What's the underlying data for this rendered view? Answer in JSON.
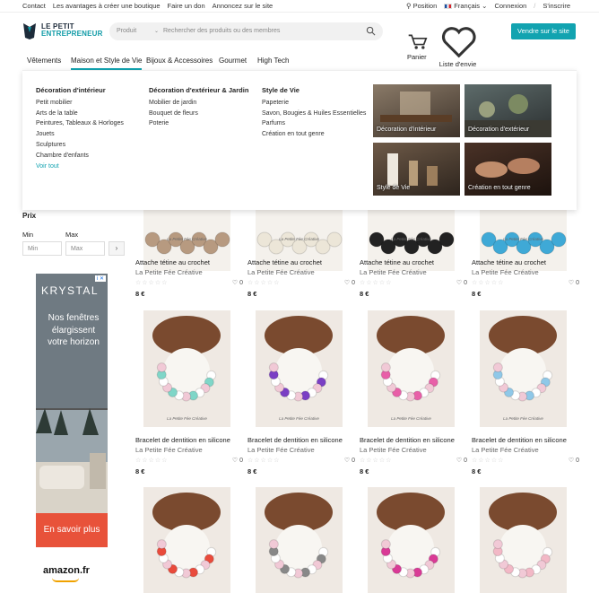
{
  "topbar": {
    "links": [
      "Contact",
      "Les avantages à créer une boutique",
      "Faire un don",
      "Annoncez sur le site"
    ],
    "position": "Position",
    "language": "Français",
    "login": "Connexion",
    "slash": "/",
    "signup": "S'inscrire"
  },
  "logo": {
    "line1": "LE PETIT",
    "line2": "ENTREPRENEUR"
  },
  "search": {
    "category": "Produit",
    "placeholder": "Rechercher des produits ou des membres"
  },
  "header": {
    "cart": "Panier",
    "wishlist": "Liste d'envie",
    "sell": "Vendre sur le site"
  },
  "nav": {
    "items": [
      "Vêtements",
      "Maison et Style de Vie",
      "Bijoux & Accessoires",
      "Gourmet",
      "High Tech"
    ]
  },
  "mega": {
    "cols": [
      {
        "title": "Décoration d'intérieur",
        "links": [
          "Petit mobilier",
          "Arts de la table",
          "Peintures, Tableaux & Horloges",
          "Jouets",
          "Sculptures",
          "Chambre d'enfants"
        ],
        "all": "Voir tout"
      },
      {
        "title": "Décoration d'extérieur & Jardin",
        "links": [
          "Mobilier de jardin",
          "Bouquet de fleurs",
          "Poterie"
        ]
      },
      {
        "title": "Style de Vie",
        "links": [
          "Papeterie",
          "Savon, Bougies & Huiles Essentielles",
          "Parfums",
          "Création en tout genre"
        ]
      }
    ],
    "tiles": [
      "Décoration d'intérieur",
      "Décoration d'extérieur",
      "Style de Vie",
      "Création en tout genre"
    ]
  },
  "filters": {
    "price_label": "Prix",
    "min_label": "Min",
    "max_label": "Max",
    "min_placeholder": "Min",
    "max_placeholder": "Max",
    "go": "›"
  },
  "ad": {
    "brand": "KRYSTAL",
    "text": "Nos fenêtres élargissent votre horizon",
    "cta": "En savoir plus",
    "amazon": "amazon.fr",
    "tag": "i ✕"
  },
  "products": [
    {
      "title": "Attache tétine au crochet",
      "shop": "La Petite Fée Créative",
      "price": "8 €",
      "likes": "0",
      "color": "#b79a80"
    },
    {
      "title": "Attache tétine au crochet",
      "shop": "La Petite Fée Créative",
      "price": "8 €",
      "likes": "0",
      "color": "#ece6d8"
    },
    {
      "title": "Attache tétine au crochet",
      "shop": "La Petite Fée Créative",
      "price": "8 €",
      "likes": "0",
      "color": "#222222"
    },
    {
      "title": "Attache tétine au crochet",
      "shop": "La Petite Fée Créative",
      "price": "8 €",
      "likes": "0",
      "color": "#3fa9d6"
    },
    {
      "title": "Bracelet de dentition en silicone",
      "shop": "La Petite Fée Créative",
      "price": "8 €",
      "likes": "0",
      "color": "#7fd6c8"
    },
    {
      "title": "Bracelet de dentition en silicone",
      "shop": "La Petite Fée Créative",
      "price": "8 €",
      "likes": "0",
      "color": "#7a3fc4"
    },
    {
      "title": "Bracelet de dentition en silicone",
      "shop": "La Petite Fée Créative",
      "price": "8 €",
      "likes": "0",
      "color": "#e85fa8"
    },
    {
      "title": "Bracelet de dentition en silicone",
      "shop": "La Petite Fée Créative",
      "price": "8 €",
      "likes": "0",
      "color": "#8fc8e8"
    },
    {
      "title": "",
      "shop": "",
      "price": "",
      "likes": "",
      "color": "#e94b3c"
    },
    {
      "title": "",
      "shop": "",
      "price": "",
      "likes": "",
      "color": "#888888"
    },
    {
      "title": "",
      "shop": "",
      "price": "",
      "likes": "",
      "color": "#d93a96"
    },
    {
      "title": "",
      "shop": "",
      "price": "",
      "likes": "",
      "color": "#f2b8c6"
    }
  ],
  "card_watermark": "La Petite Fée Créative",
  "stars": "☆☆☆☆☆",
  "colors": {
    "accent": "#12a3b0"
  }
}
